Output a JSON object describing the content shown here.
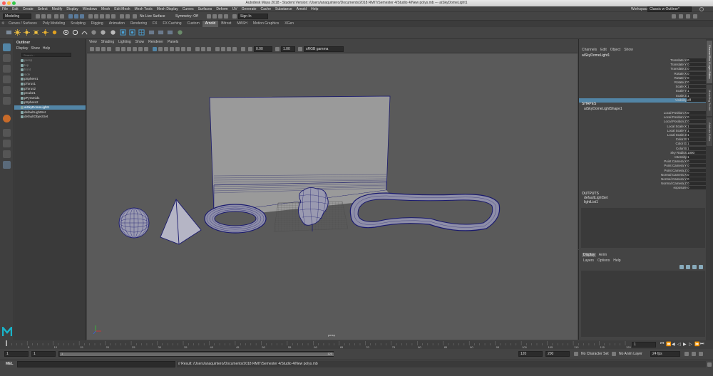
{
  "window": {
    "title": "Autodesk Maya 2018 - Student Version: /Users/anaquintero/Documents/2018 RMIT/Semester 4/Studio 4/New polys.mb    ---    aiSkyDomeLight1"
  },
  "menubar": {
    "items": [
      "File",
      "Edit",
      "Create",
      "Select",
      "Modify",
      "Display",
      "Windows",
      "Mesh",
      "Edit Mesh",
      "Mesh Tools",
      "Mesh Display",
      "Curves",
      "Surfaces",
      "Deform",
      "UV",
      "Generate",
      "Cache",
      "Substance",
      "Arnold",
      "Help"
    ],
    "workspace_label": "Workspace :",
    "workspace_value": "Classic w Outliner*"
  },
  "statusline": {
    "menuset": "Modeling",
    "live_surface": "No Live Surface",
    "symmetry": "Symmetry: Off",
    "sign_in": "Sign In"
  },
  "shelf": {
    "tabs": [
      "Curves / Surfaces",
      "Poly Modeling",
      "Sculpting",
      "Rigging",
      "Animation",
      "Rendering",
      "FX",
      "FX Caching",
      "Custom",
      "Arnold",
      "Bifrost",
      "MASH",
      "Motion Graphics",
      "XGen"
    ],
    "active_tab": "Arnold"
  },
  "outliner": {
    "title": "Outliner",
    "menus": [
      "Display",
      "Show",
      "Help"
    ],
    "search_placeholder": "Search...",
    "items": [
      {
        "label": "persp",
        "state": "dim"
      },
      {
        "label": "top",
        "state": "dim"
      },
      {
        "label": "front",
        "state": "dim"
      },
      {
        "label": "side",
        "state": "dim"
      },
      {
        "label": "pSphere1",
        "state": "normal"
      },
      {
        "label": "pTorus1",
        "state": "normal"
      },
      {
        "label": "pTorus2",
        "state": "normal"
      },
      {
        "label": "pCube1",
        "state": "normal"
      },
      {
        "label": "pPyramid1",
        "state": "normal"
      },
      {
        "label": "pSphere2",
        "state": "normal"
      },
      {
        "label": "aiSkyDomeLight1",
        "state": "sel"
      },
      {
        "label": "defaultLightSet",
        "state": "normal"
      },
      {
        "label": "defaultObjectSet",
        "state": "normal"
      }
    ]
  },
  "viewport": {
    "menus": [
      "View",
      "Shading",
      "Lighting",
      "Show",
      "Renderer",
      "Panels"
    ],
    "exposure": "0.00",
    "gamma": "1.00",
    "color_space": "sRGB gamma",
    "camera_label": "persp"
  },
  "channelbox": {
    "menus": [
      "Channels",
      "Edit",
      "Object",
      "Show"
    ],
    "object": "aiSkyDomeLight1",
    "transform_attrs": [
      {
        "label": "Translate X",
        "value": "0"
      },
      {
        "label": "Translate Y",
        "value": "0"
      },
      {
        "label": "Translate Z",
        "value": "0"
      },
      {
        "label": "Rotate X",
        "value": "0"
      },
      {
        "label": "Rotate Y",
        "value": "0"
      },
      {
        "label": "Rotate Z",
        "value": "0"
      },
      {
        "label": "Scale X",
        "value": "1"
      },
      {
        "label": "Scale Y",
        "value": "1"
      },
      {
        "label": "Scale Z",
        "value": "1"
      },
      {
        "label": "Visibility",
        "value": "off"
      }
    ],
    "shapes_header": "SHAPES",
    "shape_name": "aiSkyDomeLightShape1",
    "shape_attrs": [
      {
        "label": "Local Position X",
        "value": "0"
      },
      {
        "label": "Local Position Y",
        "value": "0"
      },
      {
        "label": "Local Position Z",
        "value": "0"
      },
      {
        "label": "Local Scale X",
        "value": "1"
      },
      {
        "label": "Local Scale Y",
        "value": "1"
      },
      {
        "label": "Local Scale Z",
        "value": "1"
      },
      {
        "label": "Color R",
        "value": "1"
      },
      {
        "label": "Color G",
        "value": "1"
      },
      {
        "label": "Color B",
        "value": "1"
      },
      {
        "label": "Sky Radius",
        "value": "1000"
      },
      {
        "label": "Intensity",
        "value": "1"
      },
      {
        "label": "Point Camera X",
        "value": "0"
      },
      {
        "label": "Point Camera Y",
        "value": "0"
      },
      {
        "label": "Point Camera Z",
        "value": "0"
      },
      {
        "label": "Normal Camera X",
        "value": "0"
      },
      {
        "label": "Normal Camera Y",
        "value": "0"
      },
      {
        "label": "Normal Camera Z",
        "value": "0"
      },
      {
        "label": "exposure",
        "value": "0"
      }
    ],
    "outputs_header": "OUTPUTS",
    "outputs": [
      "defaultLightSet",
      "lightList1"
    ]
  },
  "layers": {
    "tabs": [
      "Display",
      "Anim"
    ],
    "menus": [
      "Layers",
      "Options",
      "Help"
    ]
  },
  "sidetabs": [
    "Channel Box / Layer Editor",
    "Modelling Toolkit",
    "Attribute Editor"
  ],
  "timeline": {
    "ticks": [
      "5",
      "10",
      "15",
      "20",
      "25",
      "30",
      "35",
      "40",
      "45",
      "50",
      "55",
      "60",
      "65",
      "70",
      "75",
      "80",
      "85",
      "90",
      "95",
      "100",
      "105",
      "110",
      "115",
      "120"
    ],
    "current_frame": "1"
  },
  "range": {
    "start": "1",
    "start_inner": "1",
    "slider_start": "1",
    "slider_end": "120",
    "end_inner": "120",
    "end": "200",
    "character_set": "No Character Set",
    "anim_layer": "No Anim Layer",
    "fps": "24 fps"
  },
  "cmdline": {
    "lang": "MEL",
    "result": "// Result: /Users/anaquintero/Documents/2018 RMIT/Semester 4/Studio 4/New polys.mb"
  },
  "colors": {
    "selection": "#5285a6",
    "wireframe": "#1a1a6e",
    "viewport_bg": "#5a5a5a",
    "maya_logo": "#19b3c8"
  }
}
